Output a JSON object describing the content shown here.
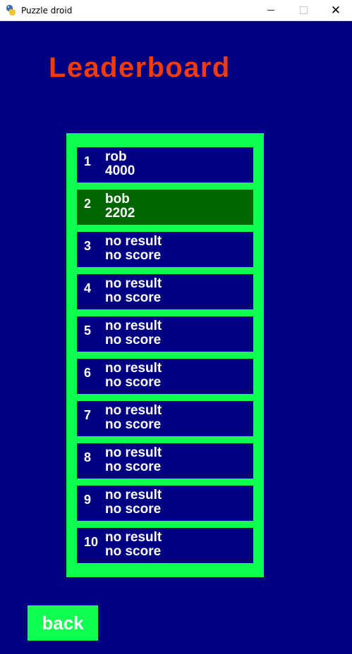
{
  "window": {
    "title": "Puzzle droid",
    "icon": "python-icon",
    "controls": {
      "minimize": "minimize-icon",
      "maximize": "maximize-icon",
      "close": "✕"
    }
  },
  "heading": "Leaderboard",
  "colors": {
    "background": "#000080",
    "heading": "#f03c0c",
    "board_frame": "#10ff50",
    "highlight_row": "#006400",
    "text": "#ffffff"
  },
  "leaderboard": {
    "entries": [
      {
        "rank": "1",
        "name": "rob",
        "score": "4000",
        "highlighted": false
      },
      {
        "rank": "2",
        "name": "bob",
        "score": "2202",
        "highlighted": true
      },
      {
        "rank": "3",
        "name": "no result",
        "score": "no score",
        "highlighted": false
      },
      {
        "rank": "4",
        "name": "no result",
        "score": "no score",
        "highlighted": false
      },
      {
        "rank": "5",
        "name": "no result",
        "score": "no score",
        "highlighted": false
      },
      {
        "rank": "6",
        "name": "no result",
        "score": "no score",
        "highlighted": false
      },
      {
        "rank": "7",
        "name": "no result",
        "score": "no score",
        "highlighted": false
      },
      {
        "rank": "8",
        "name": "no result",
        "score": "no score",
        "highlighted": false
      },
      {
        "rank": "9",
        "name": "no result",
        "score": "no score",
        "highlighted": false
      },
      {
        "rank": "10",
        "name": "no result",
        "score": "no score",
        "highlighted": false
      }
    ]
  },
  "back_button": {
    "label": "back"
  }
}
